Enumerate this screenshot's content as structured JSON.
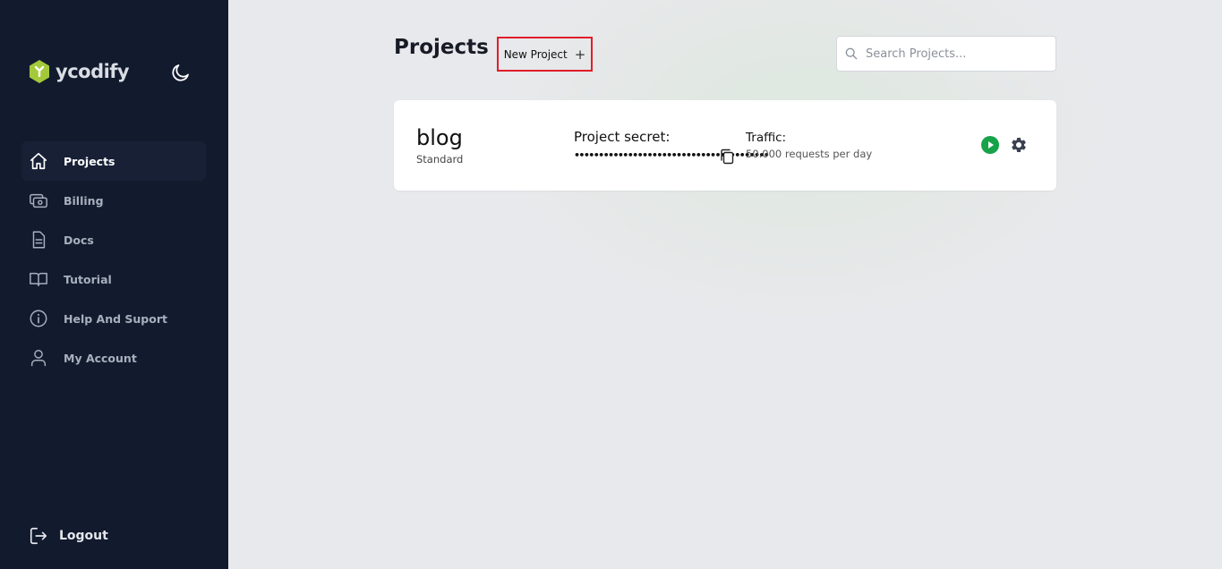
{
  "brand": {
    "name": "ycodify",
    "accent": "#a3c93a"
  },
  "sidebar": {
    "items": [
      {
        "label": "Projects",
        "icon": "home-icon",
        "active": true
      },
      {
        "label": "Billing",
        "icon": "billing-icon"
      },
      {
        "label": "Docs",
        "icon": "document-icon"
      },
      {
        "label": "Tutorial",
        "icon": "book-icon"
      },
      {
        "label": "Help And Suport",
        "icon": "info-icon"
      },
      {
        "label": "My Account",
        "icon": "user-icon"
      }
    ],
    "logout_label": "Logout"
  },
  "header": {
    "title": "Projects",
    "new_project_label": "New Project",
    "new_project_plus": "+",
    "search_placeholder": "Search Projects..."
  },
  "projects": [
    {
      "name": "blog",
      "plan": "Standard",
      "secret_label": "Project secret:",
      "secret_masked": "••••••••••••••••••••••••••••••••••••••••",
      "traffic_label": "Traffic:",
      "traffic_value": "50.000 requests per day",
      "status_color": "#16a34a"
    }
  ],
  "colors": {
    "sidebar_bg": "#121a2e",
    "highlight_border": "#e11d2a"
  }
}
